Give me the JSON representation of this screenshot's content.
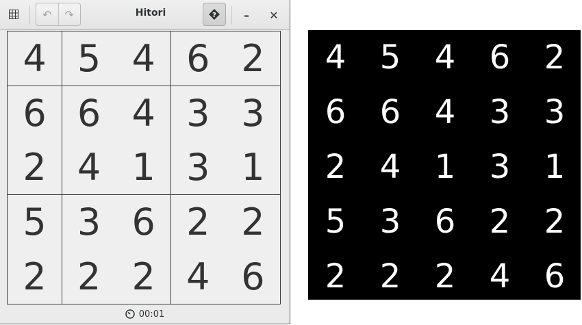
{
  "window": {
    "title": "Hitori",
    "undo_label": "↶",
    "redo_label": "↷",
    "help_label": "?",
    "minimize_label": "–",
    "close_label": "✕",
    "menu_icon": "grid-menu-icon",
    "help_icon": "help-diamond-icon"
  },
  "board": {
    "size": 5,
    "rows": [
      [
        "4",
        "5",
        "4",
        "6",
        "2"
      ],
      [
        "6",
        "6",
        "4",
        "3",
        "3"
      ],
      [
        "2",
        "4",
        "1",
        "3",
        "1"
      ],
      [
        "5",
        "3",
        "6",
        "2",
        "2"
      ],
      [
        "2",
        "2",
        "2",
        "4",
        "6"
      ]
    ]
  },
  "status": {
    "timer_icon": "clock-icon",
    "timer": "00:01"
  },
  "reference": {
    "rows": [
      [
        "4",
        "5",
        "4",
        "6",
        "2"
      ],
      [
        "6",
        "6",
        "4",
        "3",
        "3"
      ],
      [
        "2",
        "4",
        "1",
        "3",
        "1"
      ],
      [
        "5",
        "3",
        "6",
        "2",
        "2"
      ],
      [
        "2",
        "2",
        "2",
        "4",
        "6"
      ]
    ]
  },
  "colors": {
    "cell_background": "#efefef",
    "digit": "#333333",
    "panel_background": "#000000",
    "panel_digit": "#ffffff"
  }
}
